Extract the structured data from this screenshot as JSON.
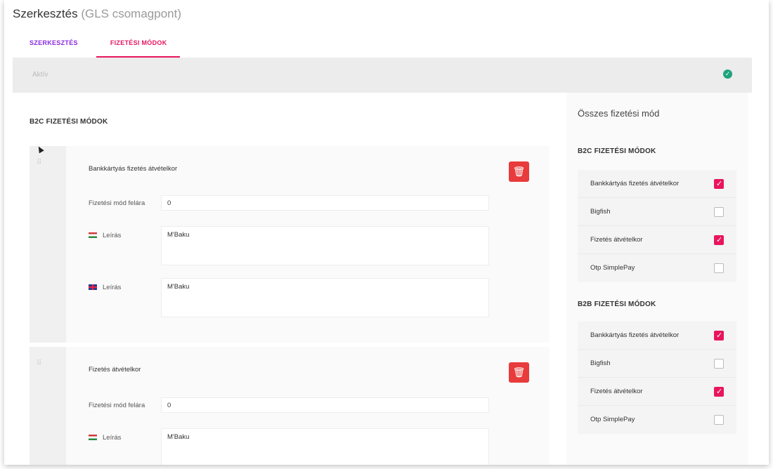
{
  "header": {
    "title": "Szerkesztés",
    "subtitle": "(GLS csomagpont)"
  },
  "tabs": [
    {
      "label": "SZERKESZTÉS",
      "active": false
    },
    {
      "label": "FIZETÉSI MÓDOK",
      "active": true
    }
  ],
  "status": {
    "label": "Aktív",
    "icon": "check-circle-icon",
    "color": "#1fa37d"
  },
  "left": {
    "section_title": "B2C FIZETÉSI MÓDOK",
    "cards": [
      {
        "name": "Bankkártyás fizetés átvételkor",
        "fee_label": "Fizetési mód felára",
        "fee_value": "0",
        "desc_hu_label": "Leírás",
        "desc_hu_value": "M'Baku",
        "desc_en_label": "Leírás",
        "desc_en_value": "M'Baku"
      },
      {
        "name": "Fizetés átvételkor",
        "fee_label": "Fizetési mód felára",
        "fee_value": "0",
        "desc_hu_label": "Leírás",
        "desc_hu_value": "M'Baku"
      }
    ]
  },
  "right": {
    "all_title": "Összes fizetési mód",
    "b2c": {
      "title": "B2C FIZETÉSI MÓDOK",
      "items": [
        {
          "label": "Bankkártyás fizetés átvételkor",
          "checked": true
        },
        {
          "label": "Bigfish",
          "checked": false
        },
        {
          "label": "Fizetés átvételkor",
          "checked": true
        },
        {
          "label": "Otp SimplePay",
          "checked": false
        }
      ]
    },
    "b2b": {
      "title": "B2B FIZETÉSI MÓDOK",
      "items": [
        {
          "label": "Bankkártyás fizetés átvételkor",
          "checked": true
        },
        {
          "label": "Bigfish",
          "checked": false
        },
        {
          "label": "Fizetés átvételkor",
          "checked": true
        },
        {
          "label": "Otp SimplePay",
          "checked": false
        }
      ]
    }
  },
  "colors": {
    "accent": "#e8155f",
    "tab_purple": "#8a2be2",
    "delete": "#e83b3b",
    "success": "#1fa37d"
  }
}
